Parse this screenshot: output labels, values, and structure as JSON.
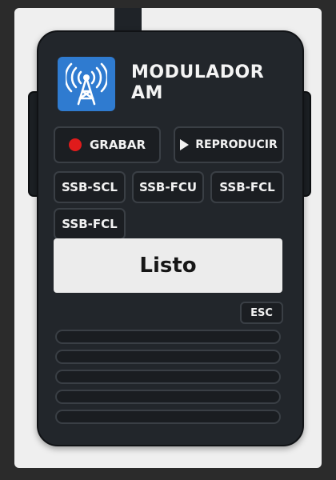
{
  "header": {
    "title": "MODULADOR AM",
    "logo_icon": "radio-tower-icon"
  },
  "controls": {
    "record_label": "GRABAR",
    "play_label": "REPRODUCIR"
  },
  "modes": [
    {
      "label": "SSB-SCL"
    },
    {
      "label": "SSB-FCU"
    },
    {
      "label": "SSB-FCL"
    },
    {
      "label": "SSB-FCL"
    }
  ],
  "display": {
    "status": "Listo"
  },
  "esc_label": "ESC",
  "colors": {
    "body": "#22262b",
    "logo_bg": "#2f7bd0",
    "record_dot": "#e01b1b",
    "display_bg": "#ececec"
  }
}
